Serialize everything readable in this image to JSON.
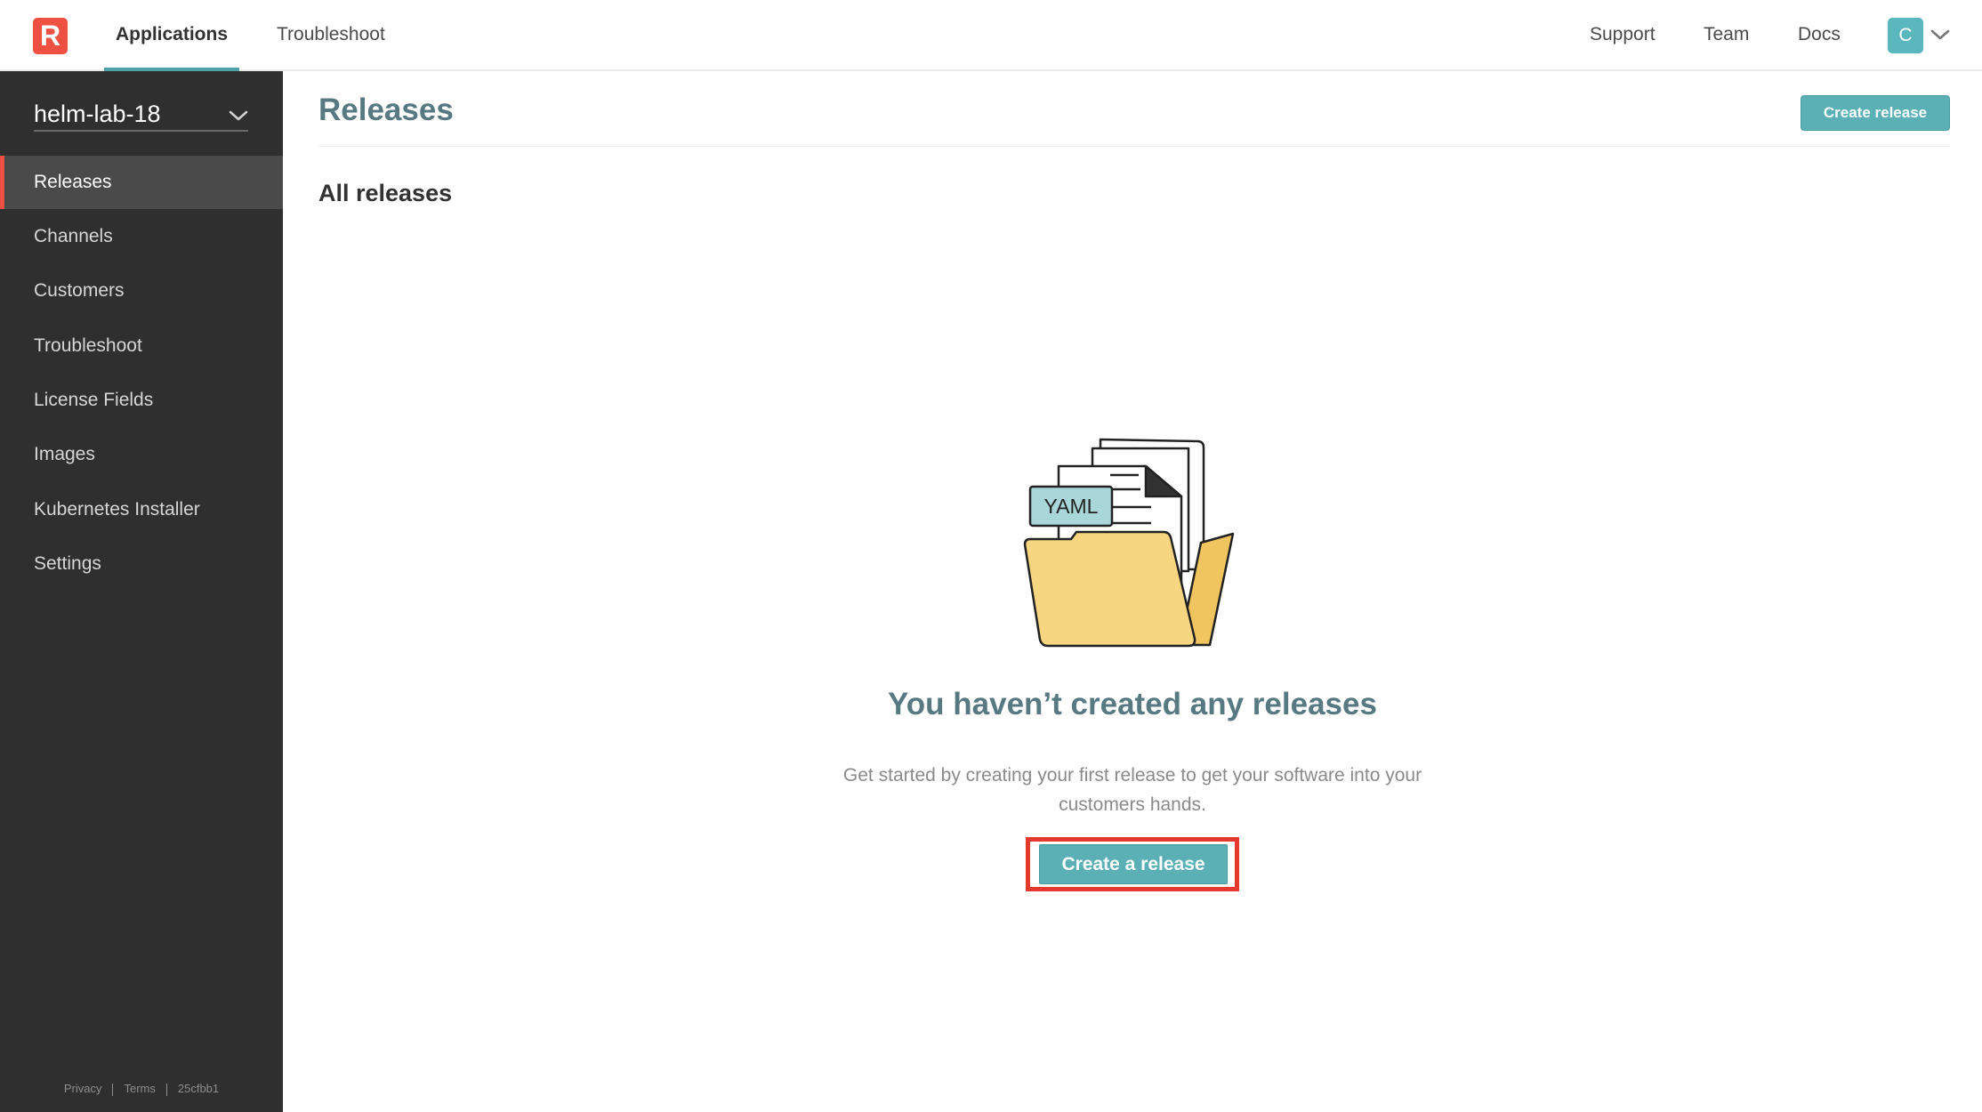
{
  "brand": {
    "logo_letter": "R"
  },
  "topnav": {
    "left": [
      "Applications",
      "Troubleshoot"
    ],
    "right": [
      "Support",
      "Team",
      "Docs"
    ],
    "avatar_initial": "C"
  },
  "sidebar": {
    "app_name": "helm-lab-18",
    "items": [
      {
        "label": "Releases",
        "active": true
      },
      {
        "label": "Channels"
      },
      {
        "label": "Customers"
      },
      {
        "label": "Troubleshoot"
      },
      {
        "label": "License Fields"
      },
      {
        "label": "Images"
      },
      {
        "label": "Kubernetes Installer"
      },
      {
        "label": "Settings"
      }
    ],
    "footer": {
      "privacy": "Privacy",
      "terms": "Terms",
      "version": "25cfbb1"
    }
  },
  "main": {
    "title": "Releases",
    "create_button": "Create release",
    "section_title": "All releases",
    "empty_state": {
      "badge": "YAML",
      "title": "You haven’t created any releases",
      "description": "Get started by creating your first release to get your software into your customers hands.",
      "button": "Create a release"
    }
  },
  "colors": {
    "accent": "#5ab0b5",
    "brand": "#ee5042",
    "sidebar": "#2f2f2f",
    "highlight": "#e4392c",
    "folder": "#f7d682"
  }
}
